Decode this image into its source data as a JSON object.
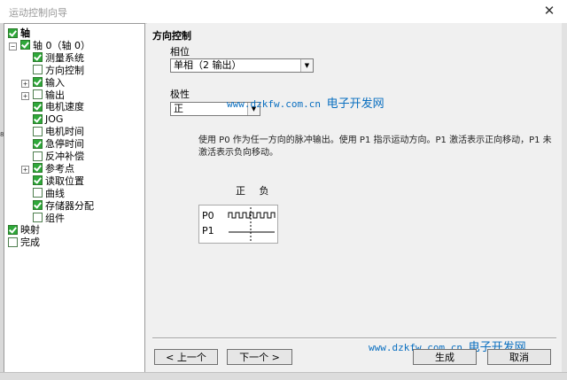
{
  "window": {
    "title": "运动控制向导",
    "close_glyph": "✕"
  },
  "strip_mark": "89",
  "tree": [
    {
      "label": "轴",
      "checked": true,
      "bold": true,
      "indent": 0,
      "expander": ""
    },
    {
      "label": "轴 0（轴 0）",
      "checked": true,
      "bold": false,
      "indent": 1,
      "expander": "−"
    },
    {
      "label": "测量系统",
      "checked": true,
      "bold": false,
      "indent": 2,
      "expander": ""
    },
    {
      "label": "方向控制",
      "checked": false,
      "bold": false,
      "indent": 2,
      "expander": ""
    },
    {
      "label": "输入",
      "checked": true,
      "bold": false,
      "indent": 2,
      "expander": "+"
    },
    {
      "label": "输出",
      "checked": false,
      "bold": false,
      "indent": 2,
      "expander": "+"
    },
    {
      "label": "电机速度",
      "checked": true,
      "bold": false,
      "indent": 2,
      "expander": ""
    },
    {
      "label": "JOG",
      "checked": true,
      "bold": false,
      "indent": 2,
      "expander": ""
    },
    {
      "label": "电机时间",
      "checked": false,
      "bold": false,
      "indent": 2,
      "expander": ""
    },
    {
      "label": "急停时间",
      "checked": true,
      "bold": false,
      "indent": 2,
      "expander": ""
    },
    {
      "label": "反冲补偿",
      "checked": false,
      "bold": false,
      "indent": 2,
      "expander": ""
    },
    {
      "label": "参考点",
      "checked": true,
      "bold": false,
      "indent": 2,
      "expander": "+"
    },
    {
      "label": "读取位置",
      "checked": true,
      "bold": false,
      "indent": 2,
      "expander": ""
    },
    {
      "label": "曲线",
      "checked": false,
      "bold": false,
      "indent": 2,
      "expander": ""
    },
    {
      "label": "存储器分配",
      "checked": true,
      "bold": false,
      "indent": 2,
      "expander": ""
    },
    {
      "label": "组件",
      "checked": false,
      "bold": false,
      "indent": 2,
      "expander": ""
    },
    {
      "label": "映射",
      "checked": true,
      "bold": false,
      "indent": 0,
      "expander": ""
    },
    {
      "label": "完成",
      "checked": false,
      "bold": false,
      "indent": 0,
      "expander": ""
    }
  ],
  "main": {
    "section_title": "方向控制",
    "phase": {
      "label": "相位",
      "value": "单相（2 输出）"
    },
    "polarity": {
      "label": "极性",
      "value": "正"
    },
    "description": "使用 P0 作为任一方向的脉冲输出。使用 P1 指示运动方向。P1 激活表示正向移动，P1 未激活表示负向移动。",
    "diagram": {
      "header": "正 负",
      "row1": "P0",
      "row2": "P1"
    }
  },
  "watermark": {
    "url": "www.dzkfw.com.cn",
    "text": "电子开发网"
  },
  "buttons": {
    "prev": "< 上一个",
    "next": "下一个 >",
    "generate": "生成",
    "cancel": "取消"
  },
  "colors": {
    "checkbox_on": "#2fa83a",
    "watermark": "#0a6fc0"
  }
}
